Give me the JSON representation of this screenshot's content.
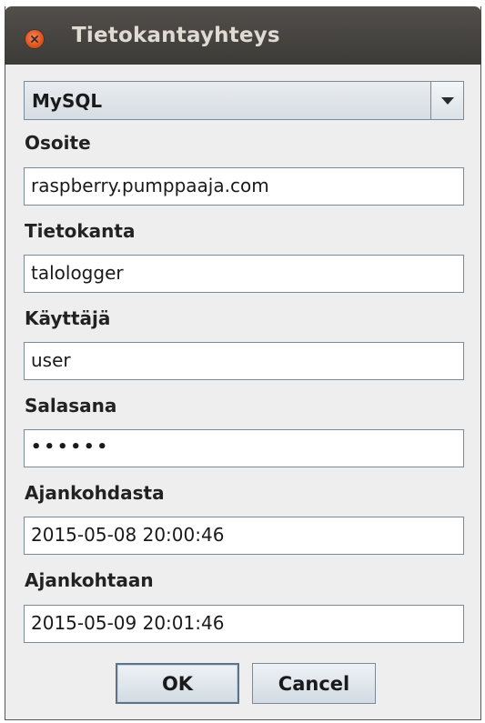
{
  "window": {
    "title": "Tietokantayhteys",
    "close_icon": "close-icon"
  },
  "database_type": {
    "selected": "MySQL",
    "arrow_icon": "chevron-down-icon"
  },
  "fields": {
    "address": {
      "label": "Osoite",
      "value": "raspberry.pumppaaja.com"
    },
    "database": {
      "label": "Tietokanta",
      "value": "talologger"
    },
    "user": {
      "label": "Käyttäjä",
      "value": "user"
    },
    "password": {
      "label": "Salasana",
      "value": "••••••"
    },
    "from_time": {
      "label": "Ajankohdasta",
      "value": "2015-05-08 20:00:46"
    },
    "to_time": {
      "label": "Ajankohtaan",
      "value": "2015-05-09 20:01:46"
    }
  },
  "buttons": {
    "ok": "OK",
    "cancel": "Cancel"
  }
}
